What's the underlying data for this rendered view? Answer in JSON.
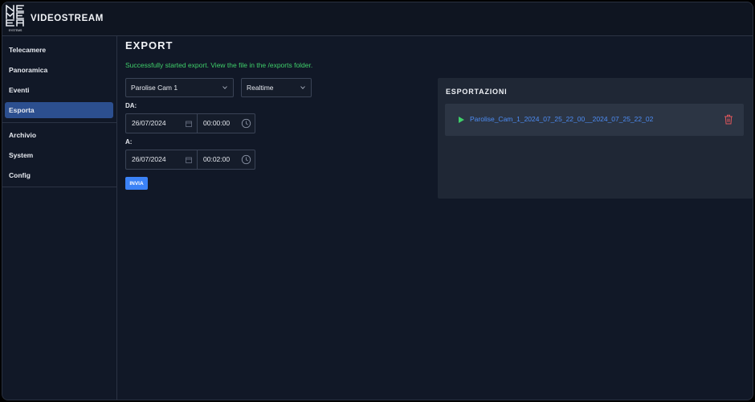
{
  "app": {
    "title": "VIDEOSTREAM",
    "logo_caption": "SYSTEMS"
  },
  "sidebar": {
    "items": [
      {
        "label": "Telecamere",
        "active": false
      },
      {
        "label": "Panoramica",
        "active": false
      },
      {
        "label": "Eventi",
        "active": false
      },
      {
        "label": "Esporta",
        "active": true
      },
      {
        "label": "Archivio",
        "active": false
      },
      {
        "label": "System",
        "active": false
      },
      {
        "label": "Config",
        "active": false
      }
    ]
  },
  "export": {
    "title": "EXPORT",
    "success_message": "Successfully started export. View the file in the /exports folder.",
    "camera_select": {
      "value": "Parolise Cam 1"
    },
    "mode_select": {
      "value": "Realtime"
    },
    "from": {
      "label": "DA:",
      "date": "26/07/2024",
      "time": "00:00:00"
    },
    "to": {
      "label": "A:",
      "date": "26/07/2024",
      "time": "00:02:00"
    },
    "submit_label": "INVIA"
  },
  "exports_panel": {
    "title": "ESPORTAZIONI",
    "items": [
      {
        "name": "Parolise_Cam_1_2024_07_25_22_00__2024_07_25_22_02"
      }
    ]
  },
  "colors": {
    "background": "#111827",
    "accent": "#2c4f8f",
    "success": "#3fcf6a",
    "link": "#4d8df5",
    "danger": "#e0565b",
    "button": "#3b82f6"
  },
  "icons": {
    "logo": "nemea-logo",
    "select_arrow": "chevron-down-icon",
    "date": "calendar-icon",
    "time": "clock-icon",
    "play": "play-icon",
    "delete": "trash-icon"
  }
}
